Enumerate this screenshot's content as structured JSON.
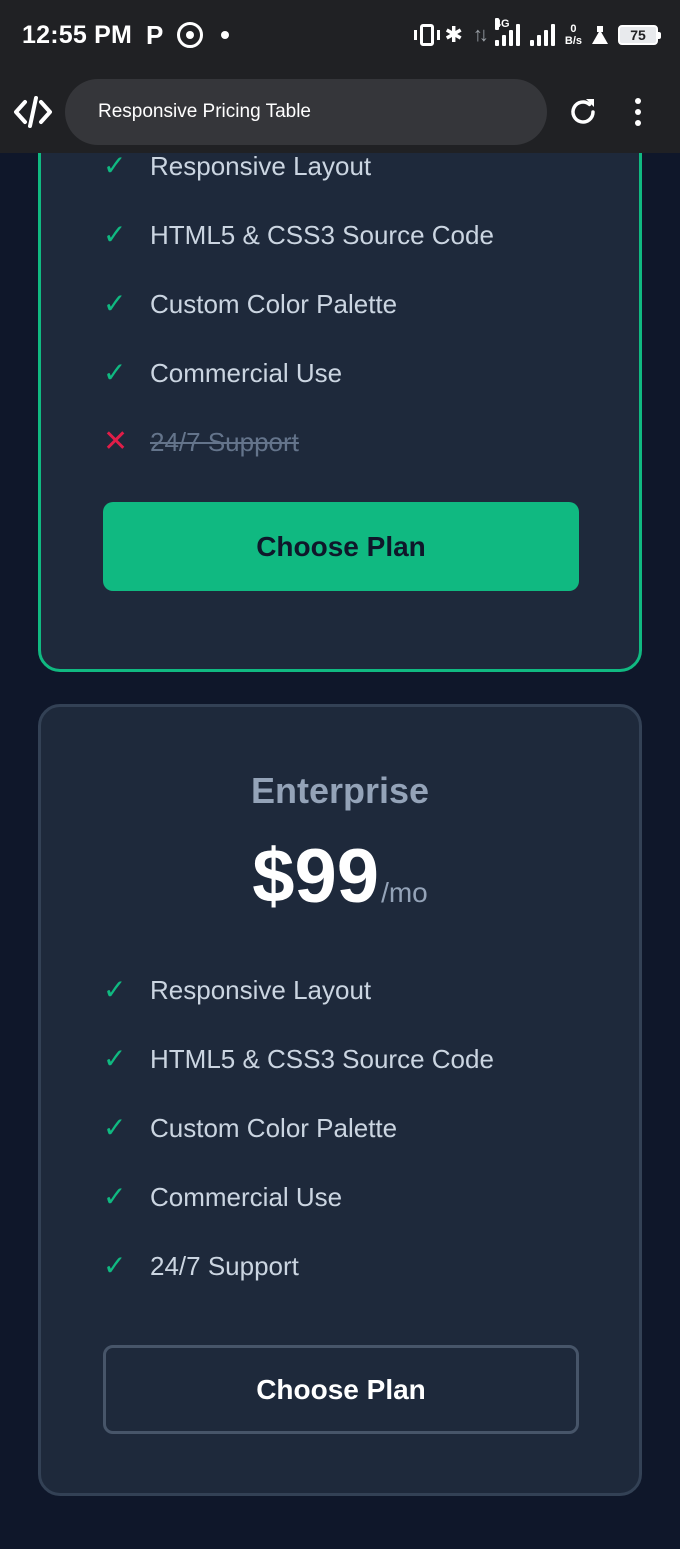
{
  "status_bar": {
    "time": "12:55 PM",
    "network": "4G",
    "speed_value": "0",
    "speed_unit": "B/s",
    "battery": "75"
  },
  "browser": {
    "url_text": "Responsive Pricing Table"
  },
  "plans": [
    {
      "features": [
        {
          "text": "Responsive Layout",
          "included": true
        },
        {
          "text": "HTML5 & CSS3 Source Code",
          "included": true
        },
        {
          "text": "Custom Color Palette",
          "included": true
        },
        {
          "text": "Commercial Use",
          "included": true
        },
        {
          "text": "24/7 Support",
          "included": false
        }
      ],
      "button_label": "Choose Plan"
    },
    {
      "name": "Enterprise",
      "price": "$99",
      "period": "/mo",
      "features": [
        {
          "text": "Responsive Layout",
          "included": true
        },
        {
          "text": "HTML5 & CSS3 Source Code",
          "included": true
        },
        {
          "text": "Custom Color Palette",
          "included": true
        },
        {
          "text": "Commercial Use",
          "included": true
        },
        {
          "text": "24/7 Support",
          "included": true
        }
      ],
      "button_label": "Choose Plan"
    }
  ],
  "marks": {
    "check": "✓",
    "cross": "✕"
  },
  "colors": {
    "page_background": "#0f172a",
    "card_background": "#1e293b",
    "accent": "#10b981",
    "cross": "#e11d48",
    "muted_text": "#94a3b8"
  }
}
